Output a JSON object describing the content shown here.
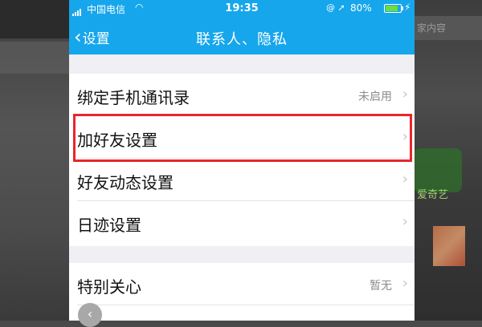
{
  "status_bar": {
    "carrier": "中国电信",
    "time": "19:35",
    "battery": "80%"
  },
  "nav": {
    "back_label": "设置",
    "title": "联系人、隐私"
  },
  "background": {
    "right_bar_text": "家内容",
    "right_green_text": "爱奇艺"
  },
  "groups": [
    {
      "items": [
        {
          "label": "绑定手机通讯录",
          "value": "未启用"
        },
        {
          "label": "加好友设置",
          "value": ""
        },
        {
          "label": "好友动态设置",
          "value": ""
        },
        {
          "label": "日迹设置",
          "value": ""
        }
      ]
    },
    {
      "items": [
        {
          "label": "特别关心",
          "value": "暂无"
        }
      ]
    }
  ],
  "highlight_color": "#e8262b",
  "header_color": "#16a6ec"
}
